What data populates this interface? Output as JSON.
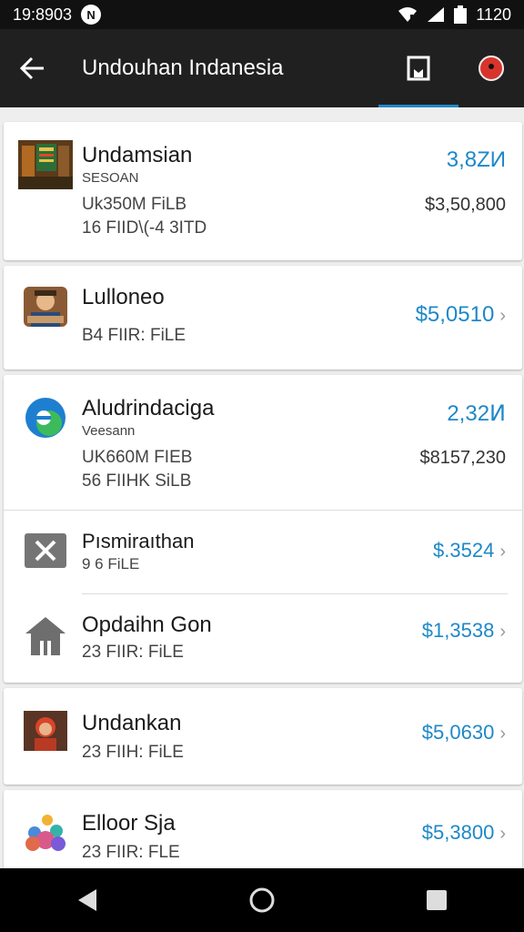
{
  "status_bar": {
    "time": "19:8903",
    "battery": "1120",
    "notif_icon": "N"
  },
  "app_bar": {
    "title": "Undouhan Indanesia"
  },
  "items": [
    {
      "name": "Undamsian",
      "sub": "SESOAN",
      "line1": "Uk350M FiLB",
      "line2": "16 FIID\\(-4 3ITD",
      "price_top": "3,8ZИ",
      "price_mid": "$3,50,800",
      "icon": "app-thumbnail-icon"
    },
    {
      "name": "Lulloneo",
      "line1": "B4 FIIR: FiLE",
      "price": "$5,0510",
      "icon": "person-thumbnail-icon"
    },
    {
      "name": "Aludrindaciga",
      "sub": "Veesann",
      "line1": "UK660M FIEB",
      "line2": "56 FIIHK SiLB",
      "price_top": "2,32Ͷ",
      "price_mid": "$8157,230",
      "icon": "edge-logo-icon"
    },
    {
      "name": "Pısmiraıthan",
      "sub": "9 6 FiLE",
      "price": "$.3524",
      "icon": "close-box-icon"
    },
    {
      "name": "Opdaihn Gon",
      "line1": "23 FIIR: FiLE",
      "price": "$1,3538",
      "icon": "house-icon"
    },
    {
      "name": "Undankan",
      "line1": "23 FIIH: FiLE",
      "price": "$5,0630",
      "icon": "character-thumbnail-icon"
    },
    {
      "name": "Elloor Sja",
      "line1": "23 FIIR: FLE",
      "price": "$5,3800",
      "icon": "people-group-icon"
    }
  ],
  "colors": {
    "accent": "#1e88c8",
    "appbar": "#202020",
    "statusbar": "#111111"
  }
}
